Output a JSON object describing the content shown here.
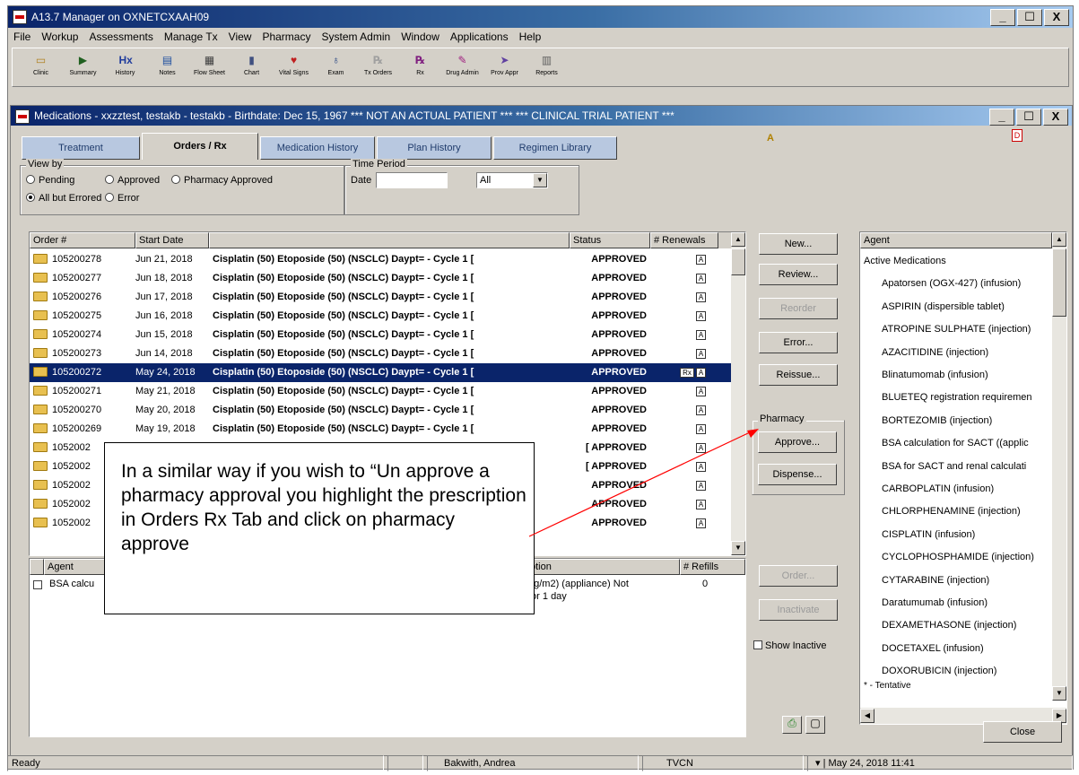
{
  "app": {
    "title": "A13.7 Manager on OXNETCXAAH09",
    "menu": [
      "File",
      "Workup",
      "Assessments",
      "Manage Tx",
      "View",
      "Pharmacy",
      "System Admin",
      "Window",
      "Applications",
      "Help"
    ],
    "toolbar": [
      {
        "label": "Clinic",
        "icon": "clinic-icon",
        "glyph": "▭",
        "color": "#b08020"
      },
      {
        "label": "Summary",
        "icon": "summary-icon",
        "glyph": "▶",
        "color": "#206020"
      },
      {
        "label": "History",
        "icon": "history-icon",
        "glyph": "Hx",
        "color": "#203c9c"
      },
      {
        "label": "Notes",
        "icon": "notes-icon",
        "glyph": "▤",
        "color": "#2050a0"
      },
      {
        "label": "Flow Sheet",
        "icon": "flowsheet-icon",
        "glyph": "▦",
        "color": "#404040"
      },
      {
        "label": "Chart",
        "icon": "chart-icon",
        "glyph": "▮",
        "color": "#405080"
      },
      {
        "label": "Vital Signs",
        "icon": "vitalsigns-icon",
        "glyph": "♥",
        "color": "#c02020"
      },
      {
        "label": "Exam",
        "icon": "exam-icon",
        "glyph": "♁",
        "color": "#204080"
      },
      {
        "label": "Tx Orders",
        "icon": "txorders-icon",
        "glyph": "℞",
        "color": "#a0a0a0"
      },
      {
        "label": "Rx",
        "icon": "rx-icon",
        "glyph": "℞",
        "color": "#802080"
      },
      {
        "label": "Drug Admin",
        "icon": "drugadmin-icon",
        "glyph": "✎",
        "color": "#a02080"
      },
      {
        "label": "Prov Appr",
        "icon": "provappr-icon",
        "glyph": "➤",
        "color": "#6040a0"
      },
      {
        "label": "Reports",
        "icon": "reports-icon",
        "glyph": "▥",
        "color": "#606060"
      }
    ],
    "window_buttons": [
      "_",
      "☐",
      "X"
    ]
  },
  "medwin": {
    "title": "Medications - xxzztest, testakb - testakb - Birthdate: Dec 15, 1967 *** NOT AN ACTUAL PATIENT *** *** CLINICAL TRIAL PATIENT ***",
    "tabs": [
      "Treatment",
      "Orders / Rx",
      "Medication History",
      "Plan History",
      "Regimen Library"
    ],
    "active_tab": 1,
    "alert_icons": [
      "A",
      "D"
    ]
  },
  "viewby": {
    "title": "View by",
    "options": [
      "Pending",
      "Approved",
      "Pharmacy Approved",
      "All but Errored",
      "Error"
    ],
    "selected": "All but Errored"
  },
  "timeperiod": {
    "title": "Time Period",
    "date_label": "Date",
    "date_value": "",
    "range_value": "All"
  },
  "orders": {
    "columns": [
      "Order #",
      "Start Date",
      "",
      "Status",
      "# Renewals"
    ],
    "rows": [
      {
        "order": "105200278",
        "date": "Jun 21, 2018",
        "desc": "Cisplatin (50) Etoposide (50) (NSCLC) Daypt= - Cycle 1 [",
        "status": "APPROVED"
      },
      {
        "order": "105200277",
        "date": "Jun 18, 2018",
        "desc": "Cisplatin (50) Etoposide (50) (NSCLC) Daypt= - Cycle 1 [",
        "status": "APPROVED"
      },
      {
        "order": "105200276",
        "date": "Jun 17, 2018",
        "desc": "Cisplatin (50) Etoposide (50) (NSCLC) Daypt= - Cycle 1 [",
        "status": "APPROVED"
      },
      {
        "order": "105200275",
        "date": "Jun 16, 2018",
        "desc": "Cisplatin (50) Etoposide (50) (NSCLC) Daypt= - Cycle 1 [",
        "status": "APPROVED"
      },
      {
        "order": "105200274",
        "date": "Jun 15, 2018",
        "desc": "Cisplatin (50) Etoposide (50) (NSCLC) Daypt= - Cycle 1 [",
        "status": "APPROVED"
      },
      {
        "order": "105200273",
        "date": "Jun 14, 2018",
        "desc": "Cisplatin (50) Etoposide (50) (NSCLC) Daypt= - Cycle 1 [",
        "status": "APPROVED"
      },
      {
        "order": "105200272",
        "date": "May 24, 2018",
        "desc": "Cisplatin (50) Etoposide (50) (NSCLC) Daypt= - Cycle 1 [",
        "status": "APPROVED"
      },
      {
        "order": "105200271",
        "date": "May 21, 2018",
        "desc": "Cisplatin (50) Etoposide (50) (NSCLC) Daypt= - Cycle 1 [",
        "status": "APPROVED"
      },
      {
        "order": "105200270",
        "date": "May 20, 2018",
        "desc": "Cisplatin (50) Etoposide (50) (NSCLC) Daypt= - Cycle 1 [",
        "status": "APPROVED"
      },
      {
        "order": "105200269",
        "date": "May 19, 2018",
        "desc": "Cisplatin (50) Etoposide (50) (NSCLC) Daypt= - Cycle 1 [",
        "status": "APPROVED"
      },
      {
        "order": "1052002",
        "date": "",
        "desc": "",
        "status": "[ APPROVED"
      },
      {
        "order": "1052002",
        "date": "",
        "desc": "",
        "status": "[ APPROVED"
      },
      {
        "order": "1052002",
        "date": "",
        "desc": "",
        "status": "APPROVED"
      },
      {
        "order": "1052002",
        "date": "",
        "desc": "",
        "status": "APPROVED"
      },
      {
        "order": "1052002",
        "date": "",
        "desc": "",
        "status": "APPROVED"
      }
    ],
    "selected_index": 6,
    "renewal_glyph": "A",
    "selected_extra_glyph": "Rx"
  },
  "actions": {
    "new": "New...",
    "review": "Review...",
    "reorder": "Reorder",
    "error": "Error...",
    "reissue": "Reissue...",
    "pharmacy_group": "Pharmacy",
    "approve": "Approve...",
    "dispense": "Dispense...",
    "order": "Order...",
    "inactivate": "Inactivate",
    "show_inactive": "Show Inactive",
    "close": "Close"
  },
  "detail": {
    "columns": [
      "Agent",
      "ption",
      "# Refills"
    ],
    "row": {
      "agent": "BSA calcu",
      "desc_line1": "ng/m2) (appliance) Not",
      "desc_line2": "for 1 day",
      "refills": "0"
    }
  },
  "agents": {
    "header": "Agent",
    "items": [
      {
        "text": "Active Medications",
        "indent": false
      },
      {
        "text": "Apatorsen (OGX-427) (infusion)",
        "indent": true
      },
      {
        "text": "ASPIRIN (dispersible tablet)",
        "indent": true
      },
      {
        "text": "ATROPINE SULPHATE (injection)",
        "indent": true
      },
      {
        "text": "AZACITIDINE (injection)",
        "indent": true
      },
      {
        "text": "Blinatumomab (infusion)",
        "indent": true
      },
      {
        "text": "BLUETEQ registration requiremen",
        "indent": true
      },
      {
        "text": "BORTEZOMIB (injection)",
        "indent": true
      },
      {
        "text": "BSA calculation for SACT ((applic",
        "indent": true
      },
      {
        "text": "BSA for SACT and renal calculati",
        "indent": true
      },
      {
        "text": "CARBOPLATIN (infusion)",
        "indent": true
      },
      {
        "text": "CHLORPHENAMINE (injection)",
        "indent": true
      },
      {
        "text": "CISPLATIN (infusion)",
        "indent": true
      },
      {
        "text": "CYCLOPHOSPHAMIDE (injection)",
        "indent": true
      },
      {
        "text": "CYTARABINE (injection)",
        "indent": true
      },
      {
        "text": "Daratumumab (infusion)",
        "indent": true
      },
      {
        "text": "DEXAMETHASONE (injection)",
        "indent": true
      },
      {
        "text": "DOCETAXEL (infusion)",
        "indent": true
      },
      {
        "text": "DOXORUBICIN (injection)",
        "indent": true
      }
    ],
    "footer": "* - Tentative"
  },
  "callout": {
    "text": "In a similar way if you wish to “Un approve a pharmacy approval you highlight the prescription in Orders Rx Tab and click on pharmacy approve",
    "arrow_color": "#ff0000"
  },
  "statusbar": {
    "left": "Ready",
    "user": "Bakwith, Andrea",
    "location": "TVCN",
    "datetime": "May 24, 2018 11:41"
  }
}
